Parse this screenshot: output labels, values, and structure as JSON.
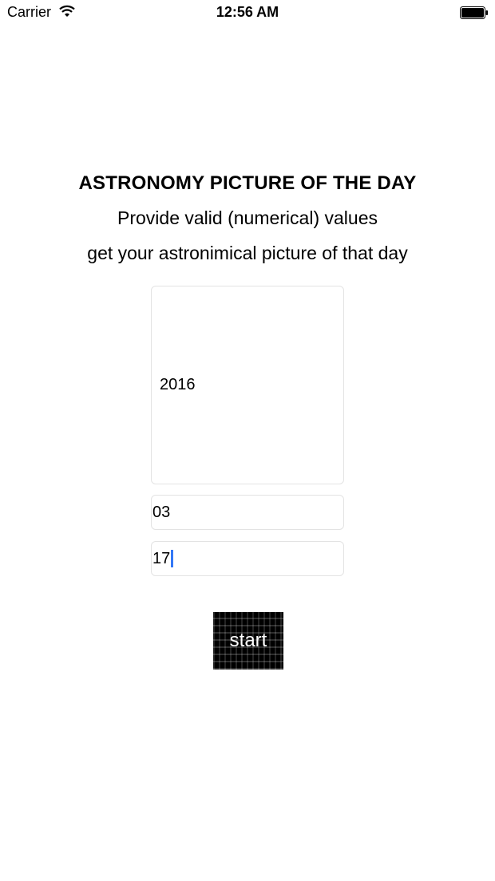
{
  "status_bar": {
    "carrier": "Carrier",
    "time": "12:56 AM",
    "icons": [
      "wifi-icon",
      "battery-icon"
    ]
  },
  "header": {
    "title": "ASTRONOMY PICTURE OF THE DAY",
    "line1": "Provide valid (numerical) values",
    "line2": "get your astronimical picture of that day"
  },
  "form": {
    "year": "2016",
    "month": "03",
    "day": "17",
    "start_label": "start"
  },
  "colors": {
    "caret": "#3478f6",
    "button_background": "#000000",
    "field_border": "#e3e3e3"
  }
}
